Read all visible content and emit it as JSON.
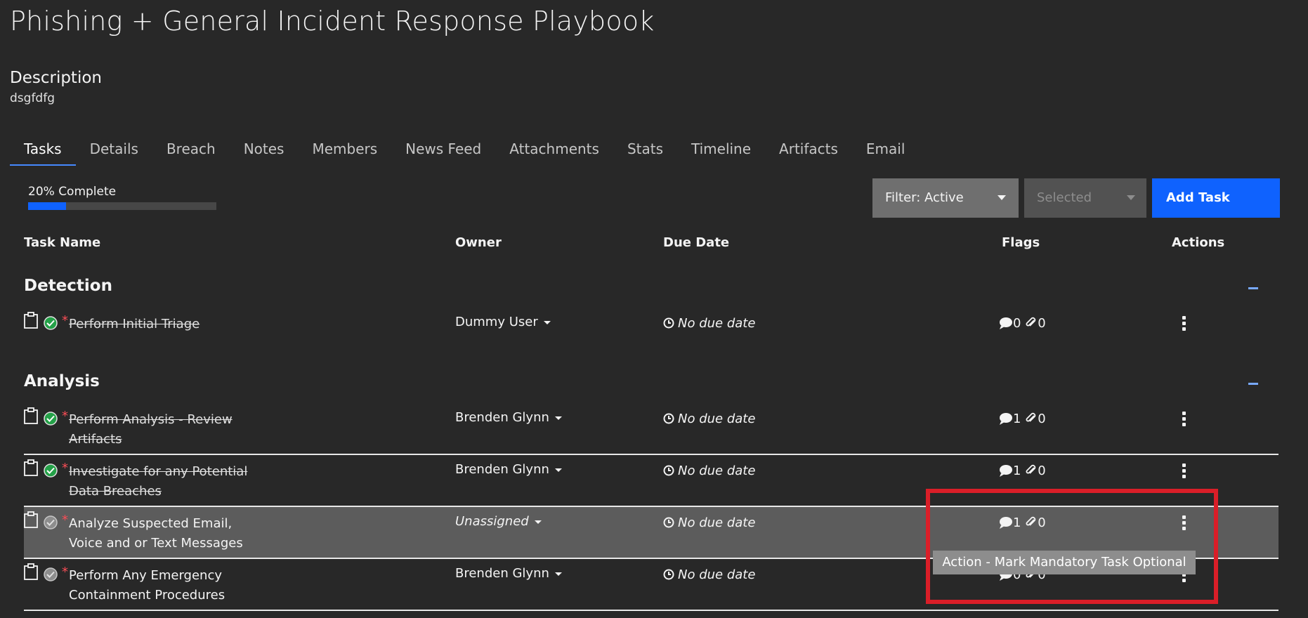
{
  "page": {
    "title": "Phishing + General Incident Response Playbook",
    "description_label": "Description",
    "description_value": "dsgfdfg"
  },
  "tabs": [
    "Tasks",
    "Details",
    "Breach",
    "Notes",
    "Members",
    "News Feed",
    "Attachments",
    "Stats",
    "Timeline",
    "Artifacts",
    "Email"
  ],
  "active_tab": "Tasks",
  "progress": {
    "label": "20% Complete",
    "percent": 20
  },
  "toolbar": {
    "filter_label": "Filter: Active",
    "selected_label": "Selected",
    "add_task_label": "Add Task"
  },
  "columns": {
    "task_name": "Task Name",
    "owner": "Owner",
    "due_date": "Due Date",
    "flags": "Flags",
    "actions": "Actions"
  },
  "sections": [
    {
      "name": "Detection",
      "tasks": [
        {
          "name": "Perform Initial Triage",
          "owner": "Dummy User",
          "due": "No due date",
          "comments": "0",
          "attachments": "0",
          "done": true
        }
      ]
    },
    {
      "name": "Analysis",
      "tasks": [
        {
          "name": "Perform Analysis - Review Artifacts",
          "owner": "Brenden Glynn",
          "due": "No due date",
          "comments": "1",
          "attachments": "0",
          "done": true
        },
        {
          "name": "Investigate for any Potential Data Breaches",
          "owner": "Brenden Glynn",
          "due": "No due date",
          "comments": "1",
          "attachments": "0",
          "done": true
        },
        {
          "name": "Analyze Suspected Email, Voice and or Text Messages",
          "owner": "Unassigned",
          "due": "No due date",
          "comments": "1",
          "attachments": "0",
          "done": false
        },
        {
          "name": "Perform Any Emergency Containment Procedures",
          "owner": "Brenden Glynn",
          "due": "No due date",
          "comments": "0",
          "attachments": "0",
          "done": false
        }
      ]
    }
  ],
  "tooltip": {
    "text": "Action - Mark Mandatory Task Optional"
  },
  "colors": {
    "accent": "#0f62fe",
    "check_done": "#24a148",
    "highlight_box": "#da1e28"
  }
}
